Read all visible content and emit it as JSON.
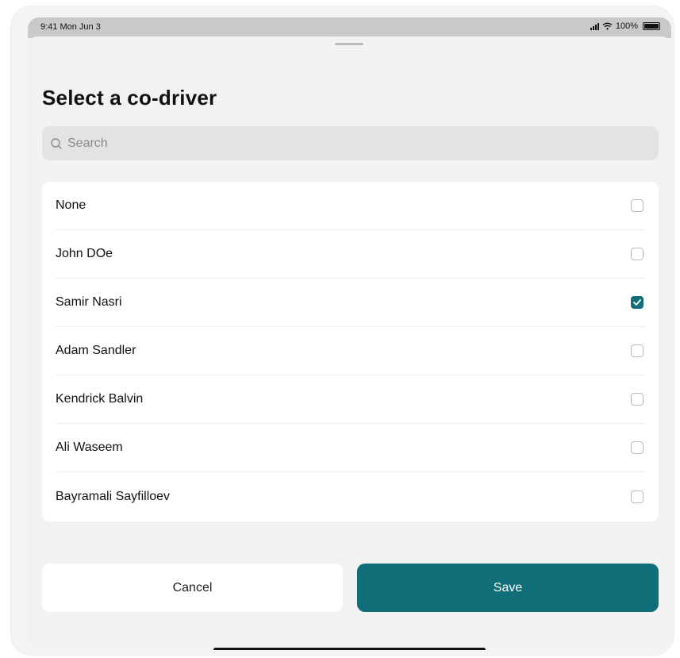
{
  "status_bar": {
    "time": "9:41 Mon Jun 3",
    "battery": "100%",
    "icons": [
      "signal-icon",
      "wifi-icon",
      "battery-icon"
    ]
  },
  "sheet": {
    "title": "Select a co-driver",
    "search": {
      "placeholder": "Search",
      "value": ""
    }
  },
  "drivers": [
    {
      "name": "None",
      "checked": false
    },
    {
      "name": "John DOe",
      "checked": false
    },
    {
      "name": "Samir Nasri",
      "checked": true
    },
    {
      "name": "Adam Sandler",
      "checked": false
    },
    {
      "name": "Kendrick Balvin",
      "checked": false
    },
    {
      "name": "Ali Waseem",
      "checked": false
    },
    {
      "name": "Bayramali Sayfilloev",
      "checked": false
    }
  ],
  "actions": {
    "cancel_label": "Cancel",
    "save_label": "Save"
  },
  "colors": {
    "accent": "#0f6e78",
    "sheet_background": "#f2f2f2",
    "card_background": "#ffffff",
    "search_background": "#e3e3e3"
  }
}
